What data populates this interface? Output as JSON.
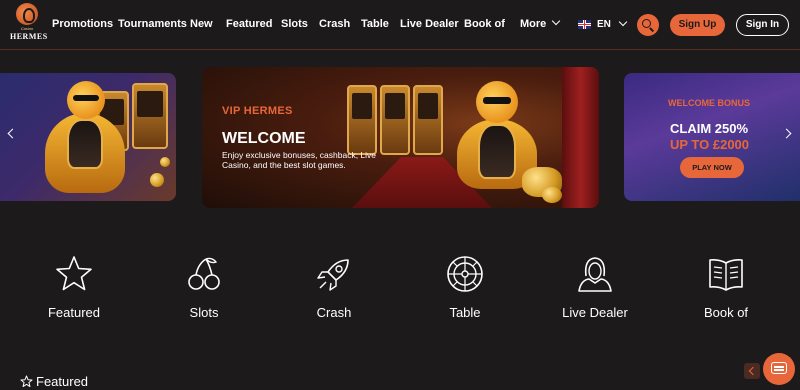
{
  "brand": {
    "small": "Casino",
    "name": "HERMES"
  },
  "nav": {
    "links": [
      "Promotions",
      "Tournaments",
      "New",
      "Featured",
      "Slots",
      "Crash",
      "Table",
      "Live Dealer",
      "Book of"
    ],
    "more_label": "More",
    "language": "EN",
    "signup_label": "Sign Up",
    "signin_label": "Sign In"
  },
  "carousel": {
    "main": {
      "label": "VIP HERMES",
      "title": "WELCOME",
      "description": "Enjoy exclusive bonuses, cashback, Live Casino, and the best slot games."
    },
    "right": {
      "label": "WELCOME BONUS",
      "headline": "CLAIM 250%",
      "subheadline": "UP TO £2000",
      "cta_label": "PLAY NOW"
    }
  },
  "categories": [
    {
      "label": "Featured",
      "icon": "star-icon"
    },
    {
      "label": "Slots",
      "icon": "cherries-icon"
    },
    {
      "label": "Crash",
      "icon": "rocket-icon"
    },
    {
      "label": "Table",
      "icon": "roulette-icon"
    },
    {
      "label": "Live Dealer",
      "icon": "dealer-icon"
    },
    {
      "label": "Book of",
      "icon": "book-icon"
    }
  ],
  "section": {
    "title": "Featured",
    "icon": "star-icon"
  },
  "colors": {
    "accent": "#e8673a",
    "background": "#1c1a1b"
  }
}
